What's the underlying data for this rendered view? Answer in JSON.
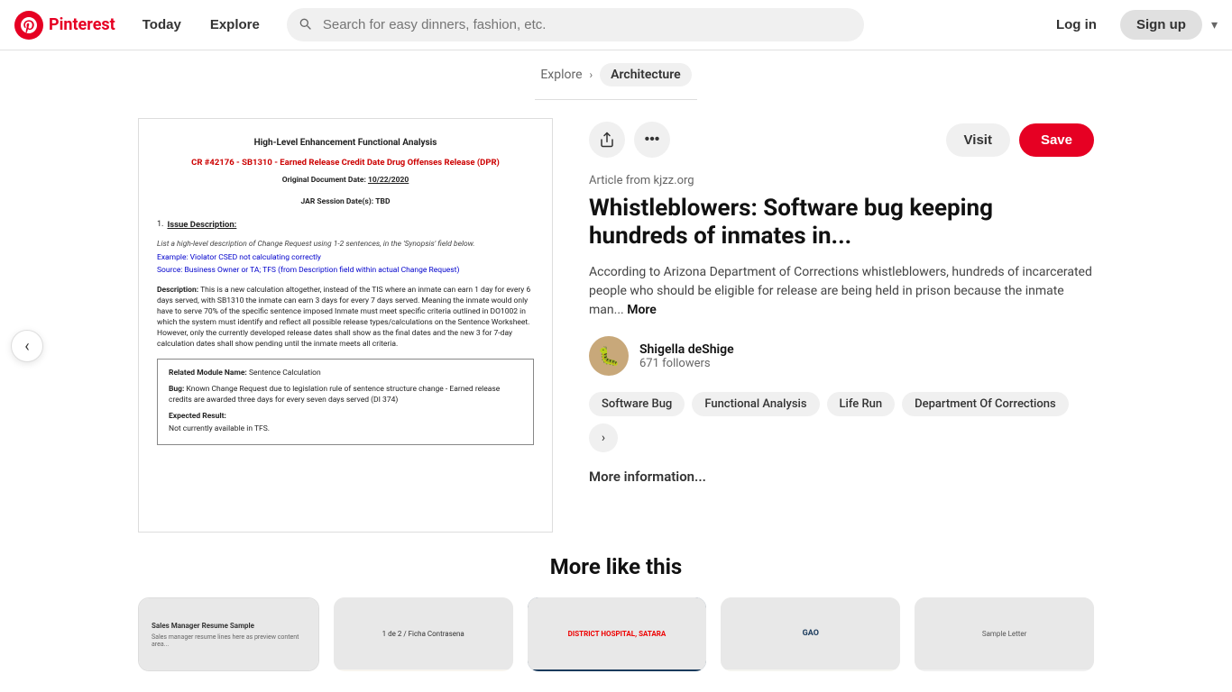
{
  "header": {
    "logo_text": "Pinterest",
    "nav_items": [
      "Today",
      "Explore"
    ],
    "search_placeholder": "Search for easy dinners, fashion, etc.",
    "login_label": "Log in",
    "signup_label": "Sign up"
  },
  "breadcrumb": {
    "explore_label": "Explore",
    "category_label": "Architecture"
  },
  "document": {
    "title": "High-Level Enhancement Functional Analysis",
    "cr_line": "CR #42176 - SB1310 - Earned Release Credit Date Drug Offenses Release (DPR)",
    "original_date_label": "Original Document Date:",
    "original_date_value": "10/22/2020",
    "jar_label": "JAR Session Date(s):",
    "jar_value": "TBD",
    "section1_title": "Issue Description:",
    "section1_italic": "List a high-level description of Change Request using 1-2 sentences, in the 'Synopsis' field below.",
    "section1_example": "Example: Violator CSED not calculating correctly",
    "section1_source": "Source: Business Owner or TA; TFS (from Description field within actual Change Request)",
    "section1_desc_label": "Description:",
    "section1_desc": "This is a new calculation altogether, instead of the TIS where an inmate can earn 1 day for every 6 days served, with SB1310 the inmate can earn 3 days for every 7 days served. Meaning the inmate would only have to serve 70% of the specific sentence imposed Inmate must meet specific criteria outlined in DO1002 in which the system must identify and reflect all possible release types/calculations on the Sentence Worksheet. However, only the currently developed release dates shall show as the final dates and the new 3 for 7-day calculation dates shall show pending until the inmate meets all criteria.",
    "box_module_label": "Related Module Name:",
    "box_module_value": "Sentence Calculation",
    "box_bug_label": "Bug:",
    "box_bug_value": "Known Change Request due to legislation rule of sentence structure change - Earned release credits are awarded three days for every seven days served (DI 374)",
    "box_expected_label": "Expected Result:",
    "box_expected_value": "Not currently available in TFS."
  },
  "article": {
    "source": "Article from kjzz.org",
    "title": "Whistleblowers: Software bug keeping hundreds of inmates in...",
    "excerpt": "According to Arizona Department of Corrections whistleblowers, hundreds of incarcerated people who should be eligible for release are being held in prison because the inmate man...",
    "more_label": "More",
    "upload_icon": "↑",
    "more_options_icon": "•••",
    "visit_label": "Visit",
    "save_label": "Save"
  },
  "author": {
    "name": "Shigella deShige",
    "followers": "671 followers",
    "avatar_emoji": "🐛"
  },
  "tags": [
    "Software Bug",
    "Functional Analysis",
    "Life Run",
    "Department Of Corrections"
  ],
  "more_info_label": "More information...",
  "more_like_this": {
    "title": "More like this",
    "cards": [
      {
        "label": "Sales Manager Resume Sample"
      },
      {
        "label": "1 de 2 / Ficha Contrasena"
      },
      {
        "label": "DISTRICT HOSPITAL, SATARA"
      },
      {
        "label": "GAO"
      },
      {
        "label": "Sample Letter"
      }
    ]
  }
}
